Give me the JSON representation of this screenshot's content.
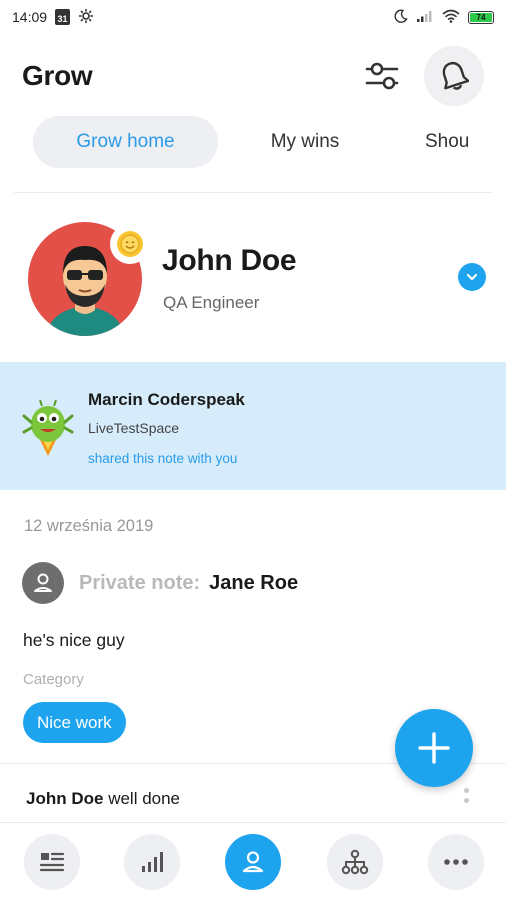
{
  "status_bar": {
    "time": "14:09",
    "calendar_day": "31",
    "battery_level": "74"
  },
  "header": {
    "title": "Grow",
    "icons": [
      "filter-icon",
      "bell-icon"
    ]
  },
  "tabs": [
    {
      "label": "Grow home",
      "active": true
    },
    {
      "label": "My wins",
      "active": false
    },
    {
      "label": "Shou",
      "active": false
    }
  ],
  "profile": {
    "name": "John Doe",
    "role": "QA Engineer"
  },
  "shared_note": {
    "sender": "Marcin Coderspeak",
    "space": "LiveTestSpace",
    "text": "shared this note with you"
  },
  "note": {
    "date": "12 września 2019",
    "label": "Private note:",
    "recipient": "Jane Roe",
    "body": "he's nice guy",
    "category_label": "Category",
    "category": "Nice work"
  },
  "comment": {
    "author": "John Doe",
    "text": "well done"
  },
  "bottom_nav": [
    {
      "icon": "feed-icon",
      "active": false
    },
    {
      "icon": "stats-icon",
      "active": false
    },
    {
      "icon": "profile-icon",
      "active": true
    },
    {
      "icon": "org-chart-icon",
      "active": false
    },
    {
      "icon": "more-icon",
      "active": false
    }
  ],
  "colors": {
    "accent": "#1ea3ee",
    "shared_bg": "#d6ecfb",
    "avatar_bg": "#e35048"
  }
}
